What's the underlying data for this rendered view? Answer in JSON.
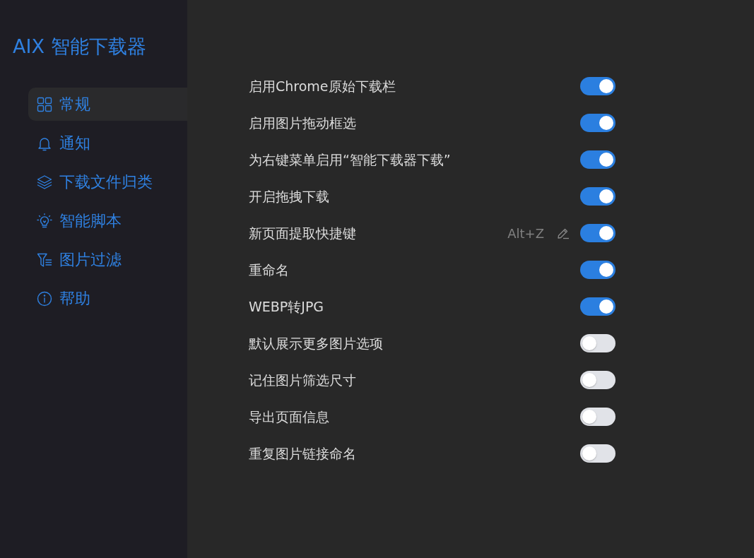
{
  "app": {
    "title": "AIX 智能下载器"
  },
  "sidebar": {
    "items": [
      {
        "label": "常规",
        "selected": true
      },
      {
        "label": "通知",
        "selected": false
      },
      {
        "label": "下载文件归类",
        "selected": false
      },
      {
        "label": "智能脚本",
        "selected": false
      },
      {
        "label": "图片过滤",
        "selected": false
      },
      {
        "label": "帮助",
        "selected": false
      }
    ]
  },
  "settings": [
    {
      "label": "启用Chrome原始下载栏",
      "on": true
    },
    {
      "label": "启用图片拖动框选",
      "on": true
    },
    {
      "label": "为右键菜单启用“智能下载器下载”",
      "on": true
    },
    {
      "label": "开启拖拽下载",
      "on": true
    },
    {
      "label": "新页面提取快捷键",
      "shortcut": "Alt+Z",
      "on": true
    },
    {
      "label": "重命名",
      "on": true
    },
    {
      "label": "WEBP转JPG",
      "on": true
    },
    {
      "label": "默认展示更多图片选项",
      "on": false
    },
    {
      "label": "记住图片筛选尺寸",
      "on": false
    },
    {
      "label": "导出页面信息",
      "on": false
    },
    {
      "label": "重复图片链接命名",
      "on": false
    }
  ]
}
